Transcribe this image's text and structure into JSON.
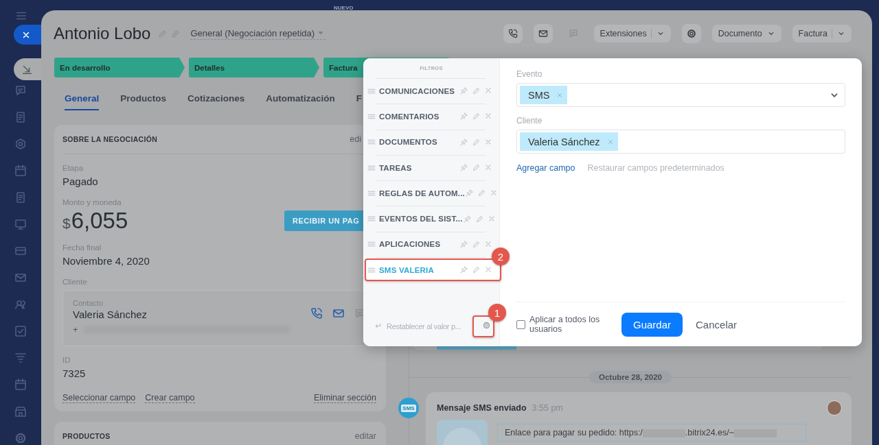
{
  "header_strip": {
    "label": "NUEVO"
  },
  "deal": {
    "title": "Antonio Lobo",
    "pipeline": "General (Negociación repetida)",
    "icon_buttons": [
      {
        "kind": "phone",
        "disabled": false
      },
      {
        "kind": "mail",
        "disabled": false
      },
      {
        "kind": "chat",
        "disabled": true
      },
      {
        "kind": "gear",
        "disabled": false
      }
    ],
    "buttons": [
      {
        "label": "Extensiones",
        "kind": "split"
      },
      {
        "label": "Documento",
        "kind": "dropdown"
      },
      {
        "label": "Factura",
        "kind": "split"
      }
    ],
    "stages": [
      {
        "label": "En desarrollo",
        "done": true
      },
      {
        "label": "Detalles",
        "done": true
      },
      {
        "label": "Factura",
        "done": true
      }
    ],
    "tabs": [
      {
        "label": "General",
        "selected": true
      },
      {
        "label": "Productos",
        "selected": false
      },
      {
        "label": "Cotizaciones",
        "selected": false
      },
      {
        "label": "Automatización",
        "selected": false
      },
      {
        "label": "F",
        "selected": false
      }
    ]
  },
  "about": {
    "title": "SOBRE LA NEGOCIACIÓN",
    "edit": "edi",
    "fields": [
      {
        "kind": "text",
        "label": "Etapa",
        "value": "Pagado"
      },
      {
        "kind": "money",
        "label": "Monto y moneda",
        "currency": "$",
        "value": "6,055",
        "action": "RECIBIR UN PAG"
      },
      {
        "kind": "text",
        "label": "Fecha final",
        "value": "Noviembre 4, 2020"
      },
      {
        "kind": "client",
        "label": "Cliente",
        "contact_label": "Contacto",
        "value": "Valeria Sánchez",
        "phone": "+"
      },
      {
        "kind": "text",
        "label": "ID",
        "value": "7325"
      }
    ],
    "links": [
      "Seleccionar campo",
      "Crear campo"
    ],
    "delete": "Eliminar sección"
  },
  "products": {
    "title": "PRODUCTOS",
    "edit": "editar"
  },
  "timeline": {
    "date": "Octubre 28, 2020",
    "entry": {
      "icon_label": "SMS",
      "title": "Mensaje SMS enviado",
      "time": "3:55 pm",
      "message": [
        "Enlace para pagar su pedido: https:/",
        ".bitrix24.es/~"
      ]
    }
  },
  "filters": {
    "header": "FILTROS",
    "presets": [
      {
        "label": "COMUNICACIONES",
        "selected": false
      },
      {
        "label": "COMENTARIOS",
        "selected": false
      },
      {
        "label": "DOCUMENTOS",
        "selected": false
      },
      {
        "label": "TAREAS",
        "selected": false
      },
      {
        "label": "REGLAS DE AUTOM...",
        "selected": false
      },
      {
        "label": "EVENTOS DEL SIST...",
        "selected": false
      },
      {
        "label": "APLICACIONES",
        "selected": false
      },
      {
        "label": "SMS VALERIA",
        "selected": true
      }
    ],
    "reset": "Restablecer al valor p...",
    "fields": [
      {
        "label": "Evento",
        "kind": "select",
        "chips": [
          "SMS"
        ]
      },
      {
        "label": "Cliente",
        "kind": "entity",
        "chips": [
          "Valeria Sánchez"
        ]
      }
    ],
    "add_field": "Agregar campo",
    "restore": "Restaurar campos predeterminados",
    "apply_all": {
      "label": "Aplicar a todos los usuarios",
      "checked": false
    },
    "save": "Guardar",
    "cancel": "Cancelar"
  },
  "callouts": [
    {
      "number": "1",
      "kind": "settings"
    },
    {
      "number": "2",
      "kind": "preset"
    }
  ]
}
